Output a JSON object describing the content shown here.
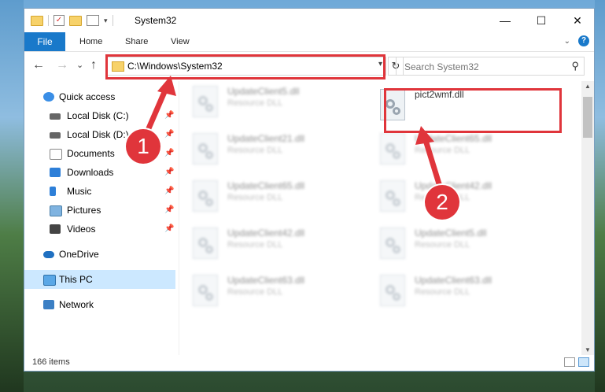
{
  "window": {
    "title": "System32",
    "controls": {
      "minimize": "—",
      "maximize": "☐",
      "close": "✕"
    }
  },
  "ribbon": {
    "file": "File",
    "tabs": [
      "Home",
      "Share",
      "View"
    ]
  },
  "nav": {
    "back": "←",
    "forward": "→",
    "recent": "⌄",
    "up": "↑",
    "address": "C:\\Windows\\System32",
    "refresh": "↻",
    "search_placeholder": "Search System32"
  },
  "sidebar": {
    "items": [
      {
        "label": "Quick access",
        "icon": "star-icon",
        "pinned": false
      },
      {
        "label": "Local Disk (C:)",
        "icon": "drive-icon",
        "pinned": true
      },
      {
        "label": "Local Disk (D:)",
        "icon": "drive-icon",
        "pinned": true
      },
      {
        "label": "Documents",
        "icon": "documents-icon",
        "pinned": true
      },
      {
        "label": "Downloads",
        "icon": "downloads-icon",
        "pinned": true
      },
      {
        "label": "Music",
        "icon": "music-icon",
        "pinned": true
      },
      {
        "label": "Pictures",
        "icon": "pictures-icon",
        "pinned": true
      },
      {
        "label": "Videos",
        "icon": "videos-icon",
        "pinned": true
      },
      {
        "label": "OneDrive",
        "icon": "onedrive-icon",
        "pinned": false
      },
      {
        "label": "This PC",
        "icon": "pc-icon",
        "pinned": false,
        "selected": true
      },
      {
        "label": "Network",
        "icon": "network-icon",
        "pinned": false
      }
    ]
  },
  "files": {
    "left": [
      {
        "name": "UpdateClient5.dll",
        "type": "Resource DLL"
      },
      {
        "name": "UpdateClient21.dll",
        "type": "Resource DLL"
      },
      {
        "name": "UpdateClient65.dll",
        "type": "Resource DLL"
      },
      {
        "name": "UpdateClient42.dll",
        "type": "Resource DLL"
      },
      {
        "name": "UpdateClient63.dll",
        "type": "Resource DLL"
      }
    ],
    "right": [
      {
        "name": "pict2wmf.dll",
        "type": ""
      },
      {
        "name": "UpdateClient65.dll",
        "type": "Resource DLL"
      },
      {
        "name": "UpdateClient42.dll",
        "type": "Resource DLL"
      },
      {
        "name": "UpdateClient5.dll",
        "type": "Resource DLL"
      },
      {
        "name": "UpdateClient63.dll",
        "type": "Resource DLL"
      }
    ]
  },
  "status": {
    "count": "166 items"
  },
  "annotations": {
    "step1": "1",
    "step2": "2",
    "color": "#e0353b"
  }
}
